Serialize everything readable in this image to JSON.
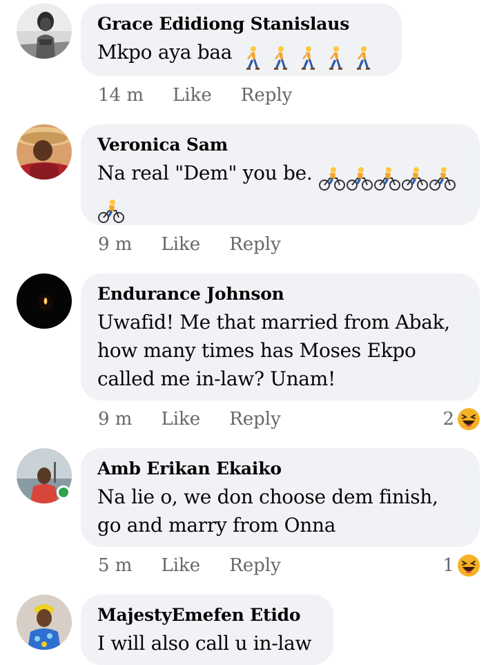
{
  "comments": [
    {
      "author": "Grace Edidiong Stanislaus",
      "text": "Mkpo aya baa",
      "emoji_kind": "person-walking-icon",
      "emoji_count": 5,
      "time": "14 m",
      "like_label": "Like",
      "reply_label": "Reply"
    },
    {
      "author": "Veronica Sam",
      "text": "Na real \"Dem\" you be.",
      "emoji_kind": "person-biking-icon",
      "emoji_count": 6,
      "time": "9 m",
      "like_label": "Like",
      "reply_label": "Reply"
    },
    {
      "author": "Endurance  Johnson",
      "text": "Uwafid! Me that married from Abak, how many times has Moses Ekpo called me in-law? Unam!",
      "time": "9 m",
      "like_label": "Like",
      "reply_label": "Reply",
      "reaction_count": "2",
      "reaction_icon": "laughing-face-icon"
    },
    {
      "author": "Amb Erikan Ekaiko",
      "text": "Na lie o, we don choose dem finish, go and marry from Onna",
      "time": "5 m",
      "like_label": "Like",
      "reply_label": "Reply",
      "reaction_count": "1",
      "reaction_icon": "laughing-face-icon",
      "online": true
    },
    {
      "author": "MajestyEmefen Etido",
      "text": "I will also call u in-law"
    }
  ],
  "colors": {
    "bubble": "#f0f2f5",
    "meta_text": "#65676b",
    "online": "#31a24c",
    "laugh": "#f7b125"
  }
}
